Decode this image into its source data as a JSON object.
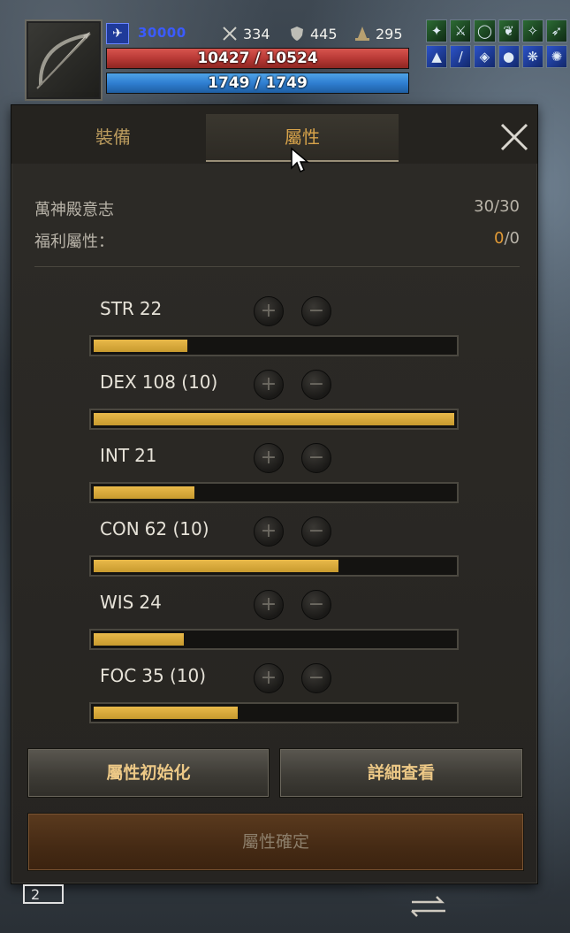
{
  "hud": {
    "exp_text": "30000",
    "attack": "334",
    "defense": "445",
    "magic": "295",
    "hp_text": "10427 / 10524",
    "hp_fraction": 0.99,
    "mp_text": "1749 / 1749",
    "mp_fraction": 1.0
  },
  "tabs": {
    "equipment": "裝備",
    "attributes": "屬性"
  },
  "info": {
    "pantheon_label": "萬神殿意志",
    "pantheon_value": "30/30",
    "bonus_label": "福利屬性：",
    "bonus_current": "0",
    "bonus_total": "/0"
  },
  "stats": [
    {
      "name": "STR",
      "value": "22",
      "fill": 0.26
    },
    {
      "name": "DEX",
      "value": "108 (10)",
      "fill": 1.0
    },
    {
      "name": "INT",
      "value": "21",
      "fill": 0.28
    },
    {
      "name": "CON",
      "value": "62 (10)",
      "fill": 0.68
    },
    {
      "name": "WIS",
      "value": "24",
      "fill": 0.25
    },
    {
      "name": "FOC",
      "value": "35 (10)",
      "fill": 0.4
    }
  ],
  "buttons": {
    "reset": "屬性初始化",
    "detail": "詳細查看",
    "confirm": "屬性確定"
  },
  "colors": {
    "accent": "#d6a24a",
    "bar_fill": "#e0b042",
    "hp": "#c0403a",
    "mp": "#3b8ad8"
  }
}
